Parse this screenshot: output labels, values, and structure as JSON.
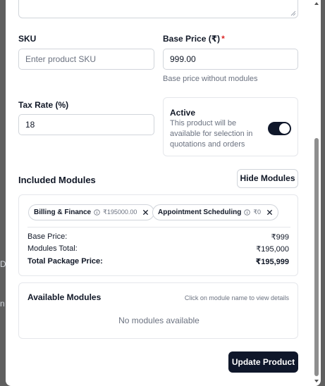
{
  "background": {
    "left_fragments": [
      "D",
      "n"
    ]
  },
  "form": {
    "sku": {
      "label": "SKU",
      "placeholder": "Enter product SKU",
      "value": ""
    },
    "base_price": {
      "label": "Base Price (₹)",
      "required_mark": "*",
      "value": "999.00",
      "hint": "Base price without modules"
    },
    "tax_rate": {
      "label": "Tax Rate (%)",
      "value": "18"
    },
    "active": {
      "title": "Active",
      "description": "This product will be available for selection in quotations and orders",
      "enabled": true
    }
  },
  "included_modules": {
    "title": "Included Modules",
    "toggle_button": "Hide Modules",
    "chips": [
      {
        "name": "Billing & Finance",
        "price": "₹195000.00",
        "icon": "info-icon",
        "close_icon": "close-icon"
      },
      {
        "name": "Appointment Scheduling",
        "price": "₹0",
        "icon": "info-icon",
        "close_icon": "close-icon"
      }
    ],
    "summary": {
      "base_price_label": "Base Price:",
      "base_price_value": "₹999",
      "modules_total_label": "Modules Total:",
      "modules_total_value": "₹195,000",
      "total_label": "Total Package Price:",
      "total_value": "₹195,999"
    }
  },
  "available_modules": {
    "title": "Available Modules",
    "hint": "Click on module name to view details",
    "empty": "No modules available"
  },
  "actions": {
    "submit": "Update Product"
  },
  "colors": {
    "primary": "#0f172a",
    "required": "#dc2626",
    "muted": "#6b7280",
    "border": "#d1d5db"
  }
}
